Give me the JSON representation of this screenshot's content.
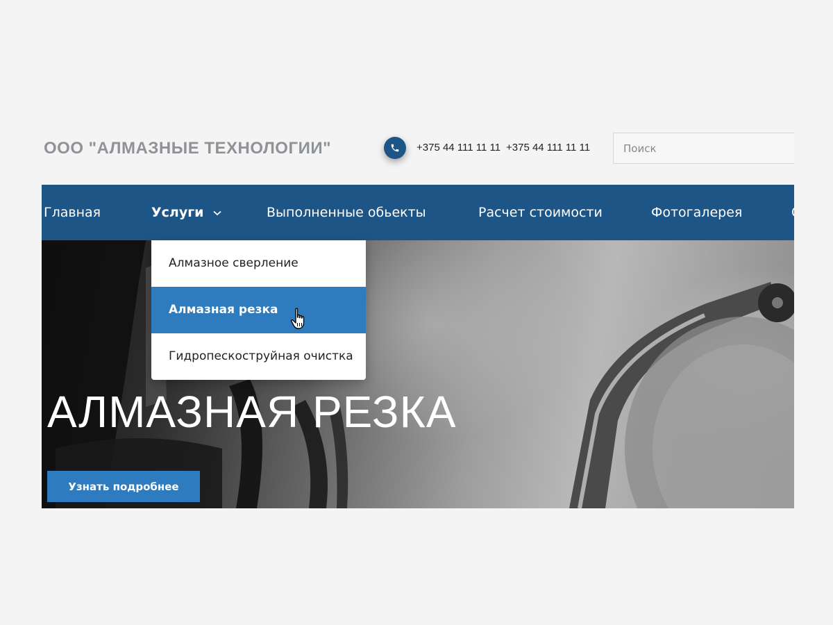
{
  "header": {
    "brand": "ООО \"АЛМАЗНЫЕ ТЕХНОЛОГИИ\"",
    "phones": [
      "+375 44 111 11 11",
      "+375 44 111 11 11"
    ],
    "phone_icon": "phone-icon",
    "search_placeholder": "Поиск"
  },
  "nav": {
    "items": [
      {
        "label": "Главная"
      },
      {
        "label": "Услуги",
        "active": true,
        "has_dropdown": true
      },
      {
        "label": "Выполненные обьекты"
      },
      {
        "label": "Расчет стоимости"
      },
      {
        "label": "Фотогалерея"
      },
      {
        "label": "С"
      }
    ]
  },
  "dropdown": {
    "items": [
      {
        "label": "Алмазное сверление"
      },
      {
        "label": "Алмазная резка",
        "hovered": true
      },
      {
        "label": "Гидропескоструйная очистка"
      }
    ]
  },
  "hero": {
    "title": "АЛМАЗНАЯ РЕЗКА",
    "cta_label": "Узнать подробнее"
  },
  "colors": {
    "nav_bg": "#1e5587",
    "accent": "#2e7bbe",
    "brand_text": "#8f9296",
    "page_bg": "#f4f4f4"
  }
}
